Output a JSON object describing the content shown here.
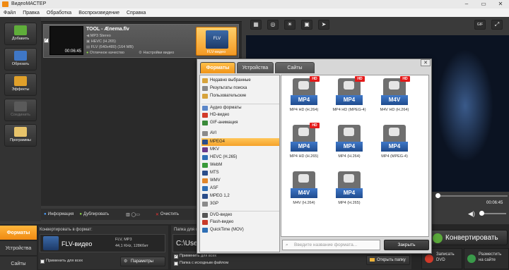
{
  "window": {
    "title": "ВидеоМАСТЕР"
  },
  "menu": [
    "Файл",
    "Правка",
    "Обработка",
    "Воспроизведение",
    "Справка"
  ],
  "sidebar": [
    {
      "label": "Добавить",
      "icon": "add-file-icon",
      "enabled": true
    },
    {
      "label": "Обрезать",
      "icon": "scissors-icon",
      "enabled": true
    },
    {
      "label": "Эффекты",
      "icon": "effects-icon",
      "enabled": true
    },
    {
      "label": "Соединить",
      "icon": "join-icon",
      "enabled": false
    },
    {
      "label": "Программы",
      "icon": "programs-icon",
      "enabled": true
    }
  ],
  "file": {
    "title": "TOOL - Ænema.flv",
    "audio": "MP3 Stereo",
    "codec": "HEVC (H.265)",
    "video": "FLV (640x480) (164 MB)",
    "quality": "Отличное качество",
    "settings": "Настройки видео",
    "duration": "00:06:45",
    "format_caption": "FLV-видео",
    "format_badge": "FLV"
  },
  "toolstrip": {
    "info": "Информация",
    "duplicate": "Дублировать",
    "clear": "Очистить"
  },
  "player": {
    "time": "00:06:45"
  },
  "bottom": {
    "tabs": [
      "Форматы",
      "Устройства",
      "Сайты"
    ],
    "convert_to_label": "Конвертировать в формат:",
    "format_name": "FLV-видео",
    "format_codec": "FLV, MP3",
    "format_audio": "44,1 KHz, 128Кбит",
    "apply_all": "Применить для всех",
    "params": "Параметры",
    "save_folder_label": "Папка для сохранения",
    "path": "C:\\Use",
    "apply_all_2": "Применить для всех",
    "source_folder": "Папка с исходным файлом",
    "open_folder": "Открыть папку",
    "convert": "Конвертировать",
    "dvd_line1": "Записать",
    "dvd_line2": "DVD",
    "site_line1": "Разместить",
    "site_line2": "на сайте"
  },
  "dialog": {
    "tabs": [
      "Форматы",
      "Устройства",
      "Сайты"
    ],
    "categories": [
      {
        "label": "Недавно выбранные",
        "icon": "recent-icon",
        "color": "#d7a33c"
      },
      {
        "label": "Результаты поиска",
        "icon": "search-icon",
        "color": "#8a8a8a"
      },
      {
        "label": "Пользовательские",
        "icon": "user-icon",
        "color": "#d7a33c"
      },
      {
        "label": "Аудио форматы",
        "icon": "audio-icon",
        "color": "#5b86c8"
      },
      {
        "label": "HD-видео",
        "icon": "hd-icon",
        "color": "#d23a2a"
      },
      {
        "label": "GIF-анимация",
        "icon": "gif-icon",
        "color": "#3a8a3a"
      },
      {
        "label": "AVI",
        "icon": "avi-icon",
        "color": "#8a8a8a"
      },
      {
        "label": "MPEG4",
        "icon": "mpeg4-icon",
        "color": "#2a4d8a"
      },
      {
        "label": "MKV",
        "icon": "mkv-icon",
        "color": "#6a3a8a"
      },
      {
        "label": "HEVC (H.265)",
        "icon": "hevc-icon",
        "color": "#2f6fb5"
      },
      {
        "label": "WebM",
        "icon": "webm-icon",
        "color": "#3a9a3a"
      },
      {
        "label": "MTS",
        "icon": "mts-icon",
        "color": "#2a4d8a"
      },
      {
        "label": "WMV",
        "icon": "wmv-icon",
        "color": "#e0862a"
      },
      {
        "label": "ASF",
        "icon": "asf-icon",
        "color": "#2f6fb5"
      },
      {
        "label": "MPEG 1,2",
        "icon": "mpeg12-icon",
        "color": "#2a4d8a"
      },
      {
        "label": "3GP",
        "icon": "3gp-icon",
        "color": "#8a8a8a"
      },
      {
        "label": "DVD-видео",
        "icon": "dvd-icon",
        "color": "#555555"
      },
      {
        "label": "Flash-видео",
        "icon": "flash-icon",
        "color": "#c83a2a"
      },
      {
        "label": "QuickTime (MOV)",
        "icon": "quicktime-icon",
        "color": "#2f6fb5"
      }
    ],
    "selected_category": "MPEG4",
    "formats": [
      {
        "badge": "MP4",
        "label": "MP4 HD (H.264)",
        "hd": "HD"
      },
      {
        "badge": "MP4",
        "label": "MP4 HD (MPEG-4)",
        "hd": "HD"
      },
      {
        "badge": "M4V",
        "label": "M4V HD (H.264)",
        "hd": "HD"
      },
      {
        "badge": "MP4",
        "label": "MP4 HD (H.265)",
        "hd": "HD"
      },
      {
        "badge": "MP4",
        "label": "MP4 (H.264)",
        "hd": ""
      },
      {
        "badge": "MP4",
        "label": "MP4 (MPEG-4)",
        "hd": ""
      },
      {
        "badge": "M4V",
        "label": "M4V (H.264)",
        "hd": ""
      },
      {
        "badge": "MP4",
        "label": "MP4 (H.265)",
        "hd": ""
      }
    ],
    "search_placeholder": "Введите название формата...",
    "close": "Закрыть"
  },
  "colors": {
    "accent": "#f39a25",
    "selected": "#f5a22a",
    "format_blue": "#2f5f9f"
  }
}
